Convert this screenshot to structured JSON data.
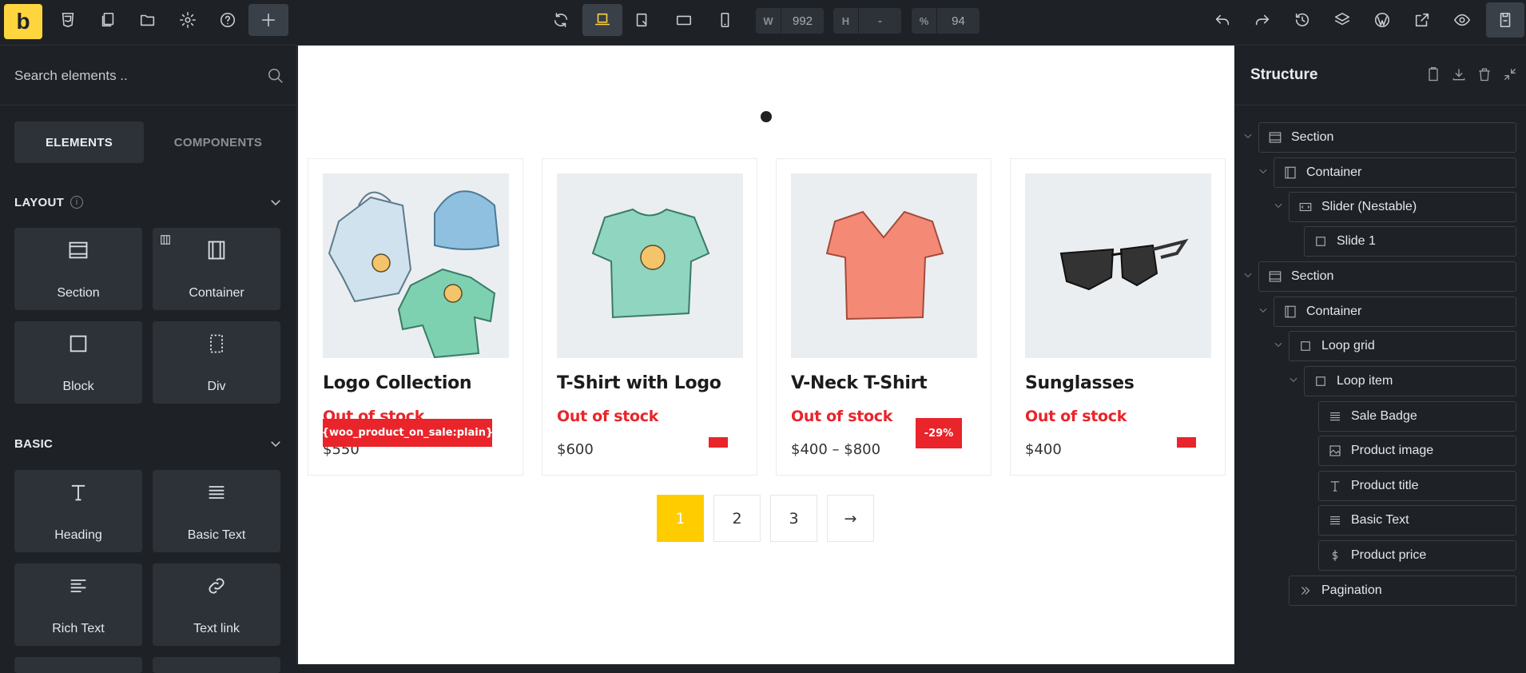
{
  "topbar": {
    "logo_letter": "b",
    "width_label": "W",
    "width_value": "992",
    "height_label": "H",
    "height_value": "-",
    "zoom_label": "%",
    "zoom_value": "94"
  },
  "left_panel": {
    "search_placeholder": "Search elements ..",
    "tabs": {
      "elements": "ELEMENTS",
      "components": "COMPONENTS"
    },
    "categories": {
      "layout": "LAYOUT",
      "basic": "BASIC"
    },
    "layout_items": [
      "Section",
      "Container",
      "Block",
      "Div"
    ],
    "basic_items": [
      "Heading",
      "Basic Text",
      "Rich Text",
      "Text link"
    ]
  },
  "canvas": {
    "products": [
      {
        "title": "Logo Collection",
        "stock": "Out of stock",
        "price": "$550",
        "sale_badge": "{woo_product_on_sale:plain}"
      },
      {
        "title": "T-Shirt with Logo",
        "stock": "Out of stock",
        "price": "$600",
        "sale_badge": ""
      },
      {
        "title": "V-Neck T-Shirt",
        "stock": "Out of stock",
        "price": "$400 – $800",
        "sale_badge": "-29%"
      },
      {
        "title": "Sunglasses",
        "stock": "Out of stock",
        "price": "$400",
        "sale_badge": ""
      }
    ],
    "pagination": [
      "1",
      "2",
      "3",
      "→"
    ]
  },
  "right_panel": {
    "title": "Structure",
    "nodes": [
      "Section",
      "Container",
      "Slider (Nestable)",
      "Slide 1",
      "Section",
      "Container",
      "Loop grid",
      "Loop item",
      "Sale Badge",
      "Product image",
      "Product title",
      "Basic Text",
      "Product price",
      "Pagination"
    ]
  },
  "colors": {
    "accent": "#ffd53e",
    "sale_red": "#e9242a",
    "pagination_active": "#ffcc00"
  }
}
